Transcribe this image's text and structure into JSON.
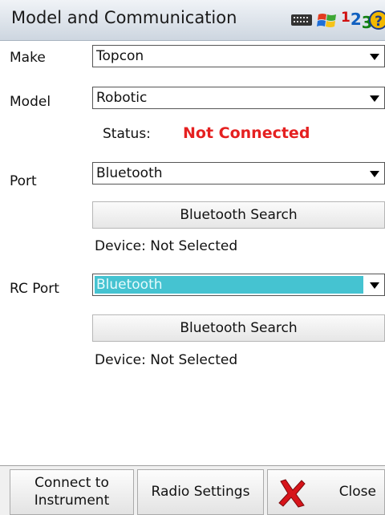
{
  "header": {
    "title": "Model and Communication",
    "tray_icons": [
      "keyboard-icon",
      "windows-flag-icon",
      "input-mode-icon",
      "help-icon"
    ],
    "input_mode_digits": [
      "1",
      "2",
      "3"
    ],
    "help_glyph": "?"
  },
  "form": {
    "make": {
      "label": "Make",
      "value": "Topcon"
    },
    "model": {
      "label": "Model",
      "value": "Robotic"
    },
    "status": {
      "label": "Status:",
      "value": "Not Connected",
      "color": "#e52020"
    },
    "port": {
      "label": "Port",
      "value": "Bluetooth",
      "search_button": "Bluetooth Search",
      "device_text": "Device: Not Selected"
    },
    "rc_port": {
      "label": "RC Port",
      "value": "Bluetooth",
      "highlight_color": "#45c3d1",
      "search_button": "Bluetooth Search",
      "device_text": "Device: Not Selected"
    }
  },
  "footer": {
    "connect_line1": "Connect to",
    "connect_line2": "Instrument",
    "radio_settings": "Radio Settings",
    "close": "Close"
  }
}
